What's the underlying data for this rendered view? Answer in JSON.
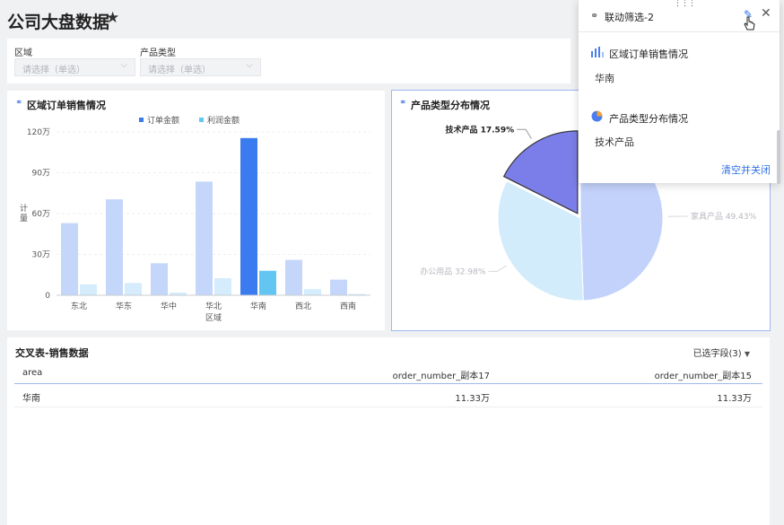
{
  "dashboard": {
    "title": "公司大盘数据",
    "star_icon": "star-icon"
  },
  "filters": [
    {
      "label": "区域",
      "placeholder": "请选择（单选）"
    },
    {
      "label": "产品类型",
      "placeholder": "请选择（单选）"
    }
  ],
  "bar_card": {
    "title": "区域订单销售情况",
    "legend": [
      "订单金额",
      "利润金额"
    ],
    "ylabel": "计量",
    "xlabel": "区域",
    "y_ticks": [
      "0",
      "30万",
      "60万",
      "90万",
      "120万"
    ]
  },
  "pie_card": {
    "title": "产品类型分布情况",
    "labels": [
      "技术产品 17.59%",
      "家具产品 49.43%",
      "办公用品 32.98%"
    ]
  },
  "popup": {
    "title": "联动筛选-2",
    "section1_title": "区域订单销售情况",
    "section1_value": "华南",
    "section2_title": "产品类型分布情况",
    "section2_value": "技术产品",
    "clear_label": "清空并关闭"
  },
  "table": {
    "title": "交叉表-销售数据",
    "fields_label": "已选字段(3)",
    "columns": [
      "area",
      "order_number_副本17",
      "order_number_副本15"
    ],
    "rows": [
      [
        "华南",
        "11.33万",
        "11.33万"
      ]
    ]
  },
  "colors": {
    "accent": "#2f6fe4",
    "bar_light": "#c5d6fb",
    "bar_dark": "#3b7bf0",
    "profit_light": "#d4ecfb",
    "profit_dark": "#63c6f2",
    "pie_tech": "#7b7ee8",
    "pie_furniture": "#c2d2fb",
    "pie_office": "#d2ecfb"
  },
  "chart_data": [
    {
      "type": "bar",
      "title": "区域订单销售情况",
      "xlabel": "区域",
      "ylabel": "计量",
      "categories": [
        "东北",
        "华东",
        "华中",
        "华北",
        "华南",
        "西北",
        "西南"
      ],
      "series": [
        {
          "name": "订单金额",
          "values": [
            530000,
            705000,
            235000,
            835000,
            1155000,
            260000,
            115000
          ]
        },
        {
          "name": "利润金额",
          "values": [
            80000,
            90000,
            20000,
            125000,
            180000,
            45000,
            10000
          ]
        }
      ],
      "ylim": [
        0,
        1200000
      ],
      "grid": true,
      "legend": "top-center",
      "highlight": "华南"
    },
    {
      "type": "pie",
      "title": "产品类型分布情况",
      "categories": [
        "技术产品",
        "家具产品",
        "办公用品"
      ],
      "values": [
        17.59,
        49.43,
        32.98
      ],
      "highlight": "技术产品"
    }
  ]
}
